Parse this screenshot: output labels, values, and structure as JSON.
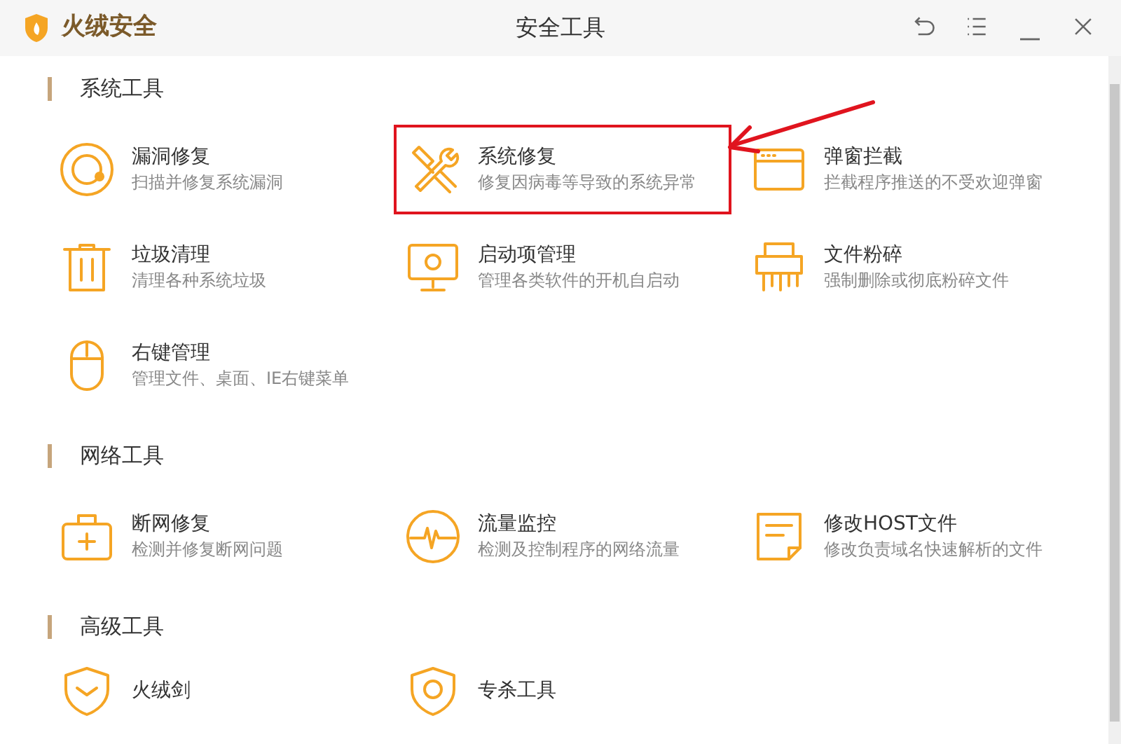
{
  "window": {
    "app_name": "火绒安全",
    "title": "安全工具"
  },
  "sections": [
    {
      "title": "系统工具",
      "tools": [
        {
          "name": "漏洞修复",
          "description": "扫描并修复系统漏洞",
          "highlighted": false
        },
        {
          "name": "系统修复",
          "description": "修复因病毒等导致的系统异常",
          "highlighted": true
        },
        {
          "name": "弹窗拦截",
          "description": "拦截程序推送的不受欢迎弹窗",
          "highlighted": false
        },
        {
          "name": "垃圾清理",
          "description": "清理各种系统垃圾",
          "highlighted": false
        },
        {
          "name": "启动项管理",
          "description": "管理各类软件的开机自启动",
          "highlighted": false
        },
        {
          "name": "文件粉碎",
          "description": "强制删除或彻底粉碎文件",
          "highlighted": false
        },
        {
          "name": "右键管理",
          "description": "管理文件、桌面、IE右键菜单",
          "highlighted": false
        }
      ]
    },
    {
      "title": "网络工具",
      "tools": [
        {
          "name": "断网修复",
          "description": "检测并修复断网问题",
          "highlighted": false
        },
        {
          "name": "流量监控",
          "description": "检测及控制程序的网络流量",
          "highlighted": false
        },
        {
          "name": "修改HOST文件",
          "description": "修改负责域名快速解析的文件",
          "highlighted": false
        }
      ]
    },
    {
      "title": "高级工具",
      "tools": [
        {
          "name": "火绒剑",
          "highlighted": false
        },
        {
          "name": "专杀工具",
          "highlighted": false
        }
      ]
    }
  ]
}
